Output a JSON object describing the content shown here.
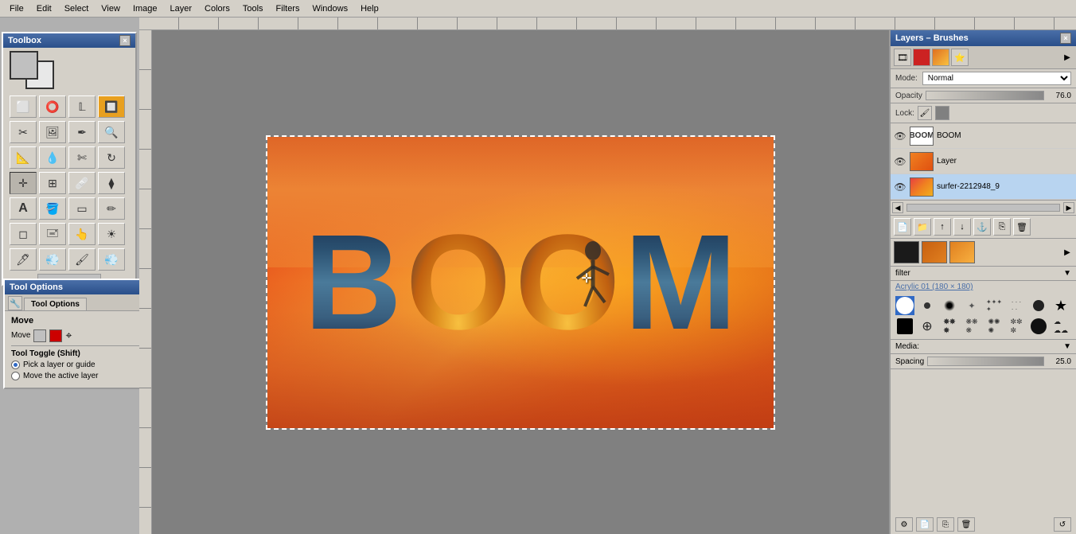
{
  "menubar": {
    "items": [
      "File",
      "Edit",
      "Select",
      "View",
      "Image",
      "Layer",
      "Colors",
      "Tools",
      "Filters",
      "Windows",
      "Help"
    ]
  },
  "toolbox": {
    "title": "Toolbox",
    "fg_color": "#c0c0c0",
    "bg_color": "#e8e8e8"
  },
  "tool_options": {
    "title": "Tool Options",
    "tab_label": "Tool Options",
    "section_move": "Move",
    "move_label": "Move",
    "toggle_label": "Tool Toggle",
    "toggle_shortcut": "(Shift)",
    "radio1_label": "Pick a layer or guide",
    "radio2_label": "Move the active layer"
  },
  "layers": {
    "title": "Layers – Brushes",
    "mode_label": "Mode:",
    "mode_value": "Normal",
    "opacity_label": "Opacity",
    "opacity_value": "76.0",
    "lock_label": "Lock:",
    "items": [
      {
        "name": "BOOM",
        "type": "boom",
        "visible": true
      },
      {
        "name": "Layer",
        "type": "orange",
        "visible": true
      },
      {
        "name": "surfer-2212948_9",
        "type": "surfer",
        "visible": true
      }
    ],
    "filter_label": "filter",
    "brush_preset": "Acrylic 01 (180 × 180)",
    "media_label": "Media:",
    "spacing_label": "Spacing",
    "spacing_value": "25.0"
  },
  "canvas": {
    "boom_text": "BOOM"
  }
}
